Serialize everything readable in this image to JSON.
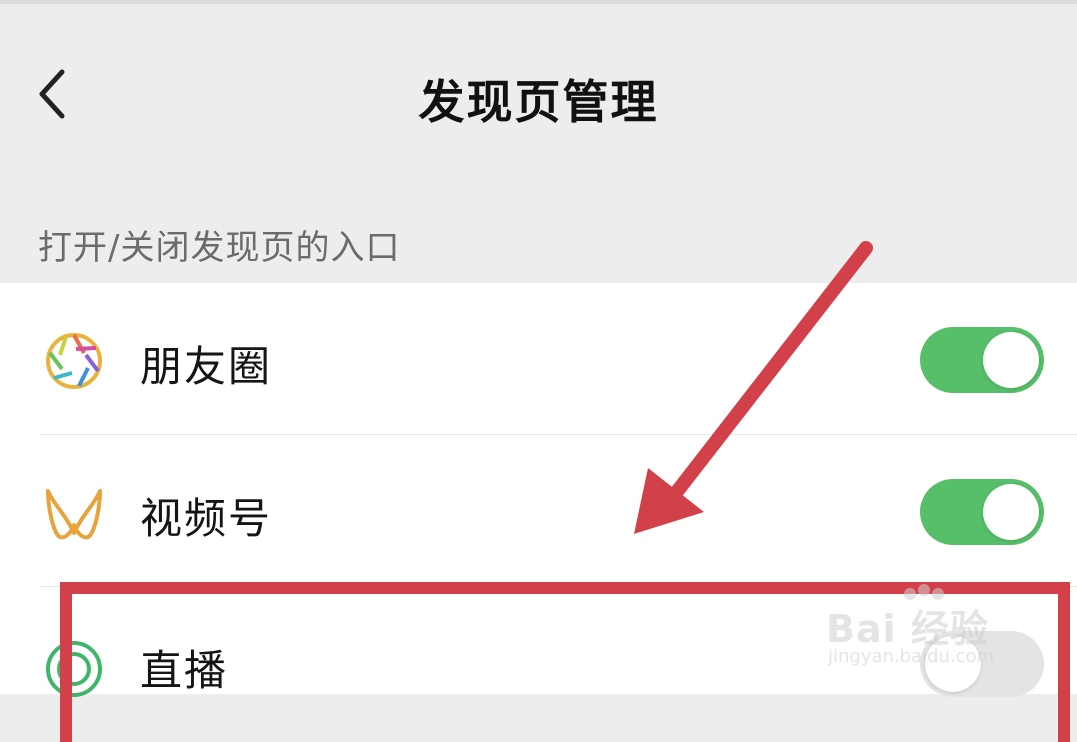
{
  "header": {
    "title": "发现页管理",
    "back_icon": "chevron-left-icon"
  },
  "section": {
    "caption": "打开/关闭发现页的入口"
  },
  "items": [
    {
      "label": "朋友圈",
      "icon": "moments-aperture-icon",
      "enabled": true
    },
    {
      "label": "视频号",
      "icon": "channels-butterfly-icon",
      "enabled": true
    },
    {
      "label": "直播",
      "icon": "live-ring-icon",
      "enabled": false
    }
  ],
  "annotation": {
    "arrow_color": "#d2414a",
    "box_color": "#d2414a"
  },
  "watermark": {
    "main": "Bai 经验",
    "sub": "jingyan.baidu.com"
  },
  "colors": {
    "toggle_on": "#57be6a",
    "toggle_off": "#e4e4e4",
    "background": "#ededed"
  }
}
